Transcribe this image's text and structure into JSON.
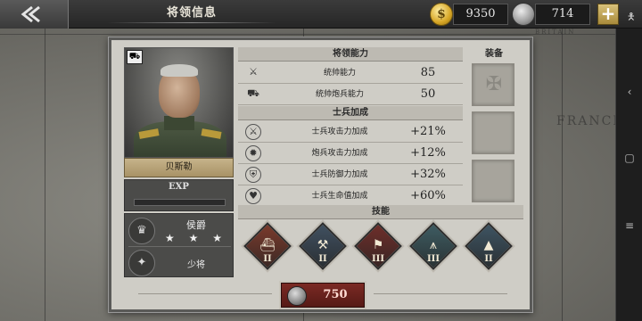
{
  "header": {
    "title": "将领信息",
    "gold": "9350",
    "medals": "714",
    "plus_label": "+"
  },
  "map": {
    "labels": [
      "FRANCE",
      "BRITAIN"
    ]
  },
  "general": {
    "name": "贝斯勒",
    "exp_label": "EXP",
    "exp_fraction": 0.0,
    "rank_title": "侯爵",
    "stars": "★ ★ ★",
    "rank": "少将"
  },
  "abilities": {
    "header": "将领能力",
    "items": [
      {
        "label": "统帅能力",
        "value": "85",
        "icon": "crossed-swords-icon"
      },
      {
        "label": "统帅炮兵能力",
        "value": "50",
        "icon": "cannon-icon"
      }
    ]
  },
  "soldier_bonus": {
    "header": "士兵加成",
    "items": [
      {
        "label": "士兵攻击力加成",
        "value": "+21%",
        "icon": "sword-icon"
      },
      {
        "label": "炮兵攻击力加成",
        "value": "+12%",
        "icon": "artillery-icon"
      },
      {
        "label": "士兵防御力加成",
        "value": "+32%",
        "icon": "shield-icon"
      },
      {
        "label": "士兵生命值加成",
        "value": "+60%",
        "icon": "heart-icon"
      }
    ]
  },
  "equipment": {
    "header": "装备"
  },
  "skills": {
    "header": "技能",
    "items": [
      {
        "level": "II",
        "color": "#7a3a2c"
      },
      {
        "level": "II",
        "color": "#405060"
      },
      {
        "level": "III",
        "color": "#6e2e2a"
      },
      {
        "level": "III",
        "color": "#3e5c62"
      },
      {
        "level": "II",
        "color": "#3e5462"
      }
    ]
  },
  "cost": {
    "value": "750"
  }
}
